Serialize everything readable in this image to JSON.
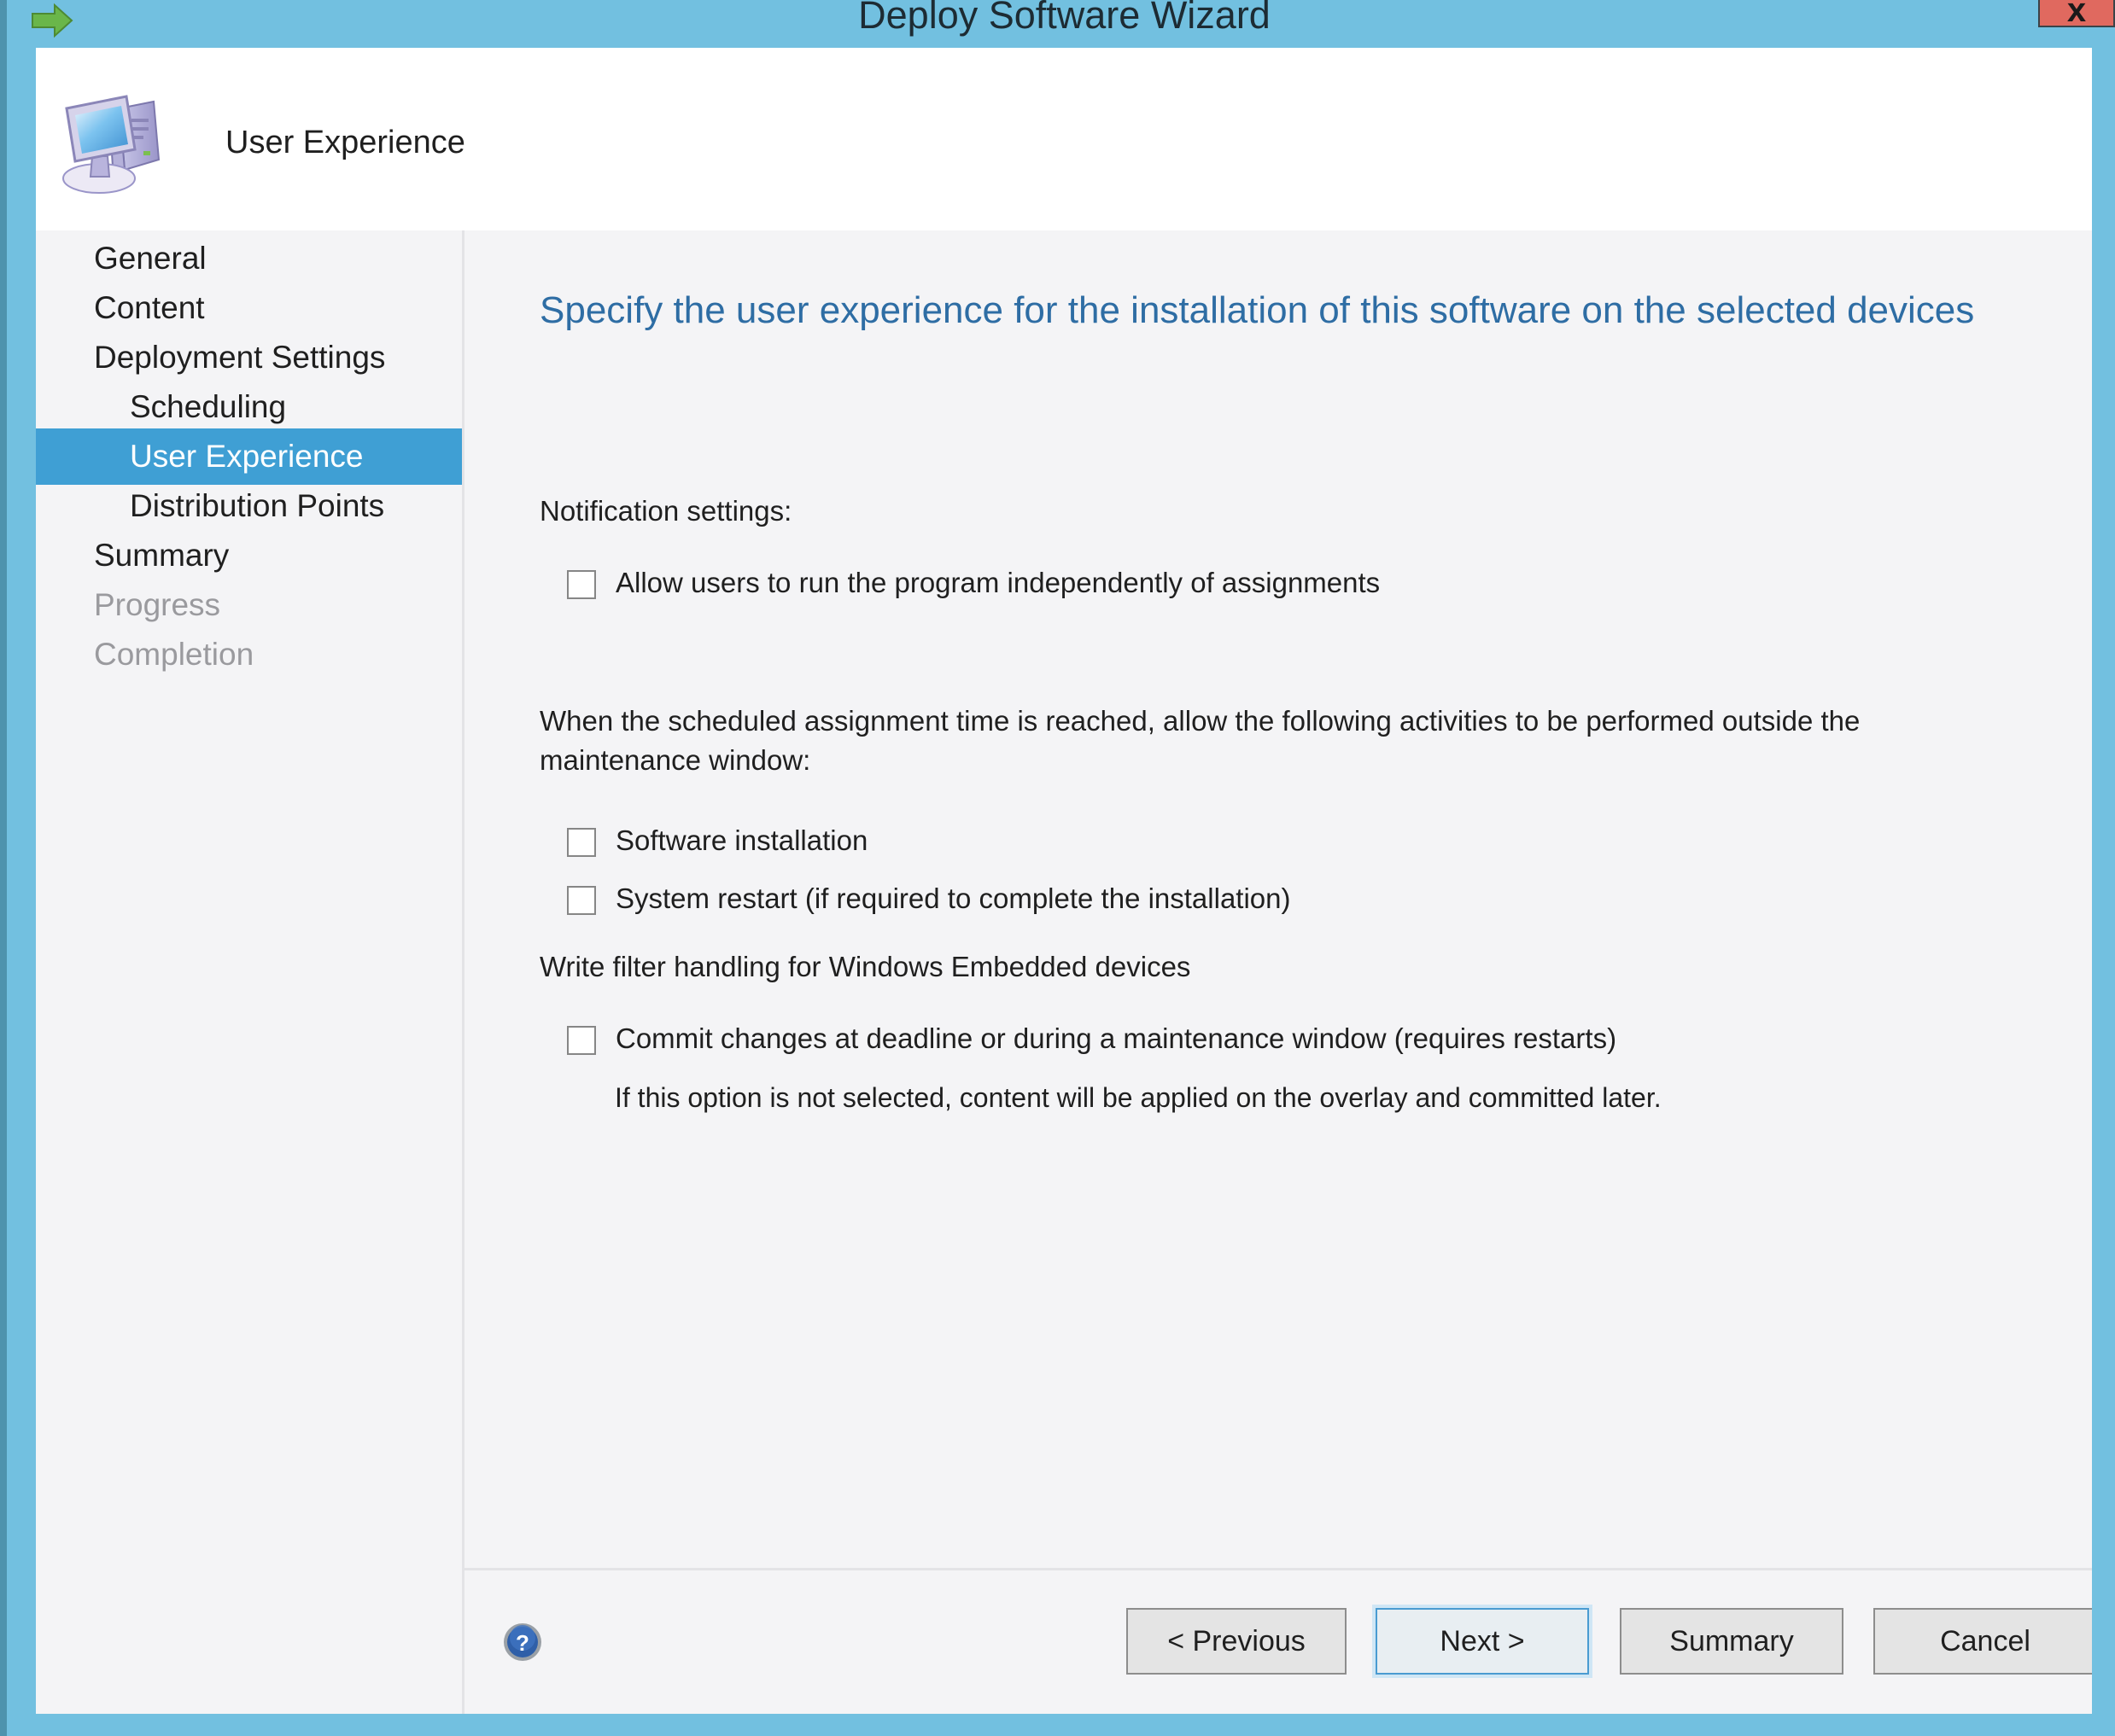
{
  "window": {
    "title": "Deploy Software Wizard",
    "close_label": "x",
    "arrow_icon": "green-right-arrow-icon",
    "frame_color": "#72c0e0",
    "close_color": "#e0695f"
  },
  "header": {
    "icon": "computer-monitor-icon",
    "title": "User Experience"
  },
  "sidebar": {
    "items": [
      {
        "label": "General",
        "level": 1,
        "state": "normal"
      },
      {
        "label": "Content",
        "level": 1,
        "state": "normal"
      },
      {
        "label": "Deployment Settings",
        "level": 1,
        "state": "normal"
      },
      {
        "label": "Scheduling",
        "level": 2,
        "state": "normal"
      },
      {
        "label": "User Experience",
        "level": 2,
        "state": "selected"
      },
      {
        "label": "Distribution Points",
        "level": 2,
        "state": "normal"
      },
      {
        "label": "Summary",
        "level": 1,
        "state": "normal"
      },
      {
        "label": "Progress",
        "level": 1,
        "state": "disabled"
      },
      {
        "label": "Completion",
        "level": 1,
        "state": "disabled"
      }
    ],
    "selected_color": "#3f9fd4"
  },
  "content": {
    "heading": "Specify the user experience for the installation of this software on the selected devices",
    "heading_color": "#2e6da4",
    "notification_label": "Notification settings:",
    "notification_checkbox": {
      "label": "Allow users to run the program independently of assignments",
      "checked": false
    },
    "maintenance_paragraph": "When the scheduled assignment time is reached, allow the following activities to be performed outside the maintenance window:",
    "maintenance_checkboxes": [
      {
        "label": "Software installation",
        "checked": false
      },
      {
        "label": "System restart (if required to complete the installation)",
        "checked": false
      }
    ],
    "write_filter_label": "Write filter handling for Windows Embedded devices",
    "write_filter_checkbox": {
      "label": "Commit changes at deadline or during a maintenance window (requires restarts)",
      "checked": false
    },
    "write_filter_note": "If this option is not selected, content will be applied on the overlay and committed later."
  },
  "footer": {
    "help_icon": "question-mark-help-icon",
    "buttons": {
      "previous": "< Previous",
      "next": "Next >",
      "summary": "Summary",
      "cancel": "Cancel"
    },
    "focused_button": "next"
  }
}
